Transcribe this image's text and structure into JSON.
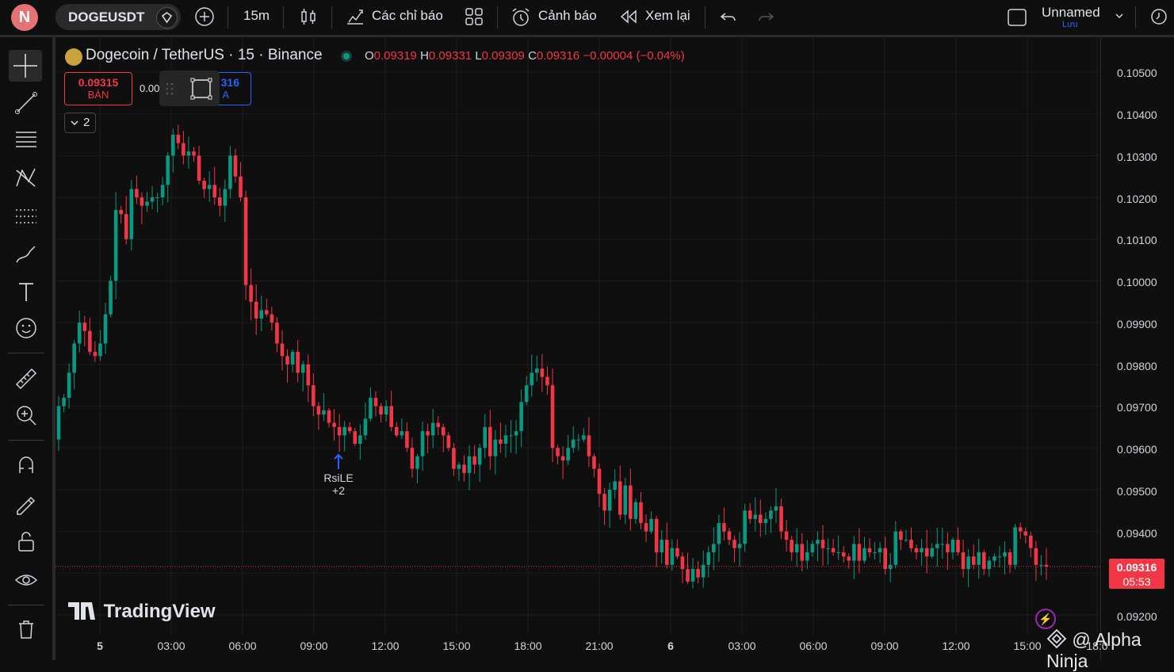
{
  "topbar": {
    "logo_letter": "N",
    "symbol": "DOGEUSDT",
    "interval": "15m",
    "indicators_label": "Các chỉ báo",
    "alerts_label": "Cảnh báo",
    "replay_label": "Xem lại",
    "layout_name": "Unnamed",
    "save_label": "Lưu"
  },
  "legend": {
    "title": "Dogecoin / TetherUS · 15 · Binance",
    "o_label": "O",
    "o_value": "0.09319",
    "h_label": "H",
    "h_value": "0.09331",
    "l_label": "L",
    "l_value": "0.09309",
    "c_label": "C",
    "c_value": "0.09316",
    "change": "−0.00004 (−0.04%)"
  },
  "trade": {
    "sell_price": "0.09315",
    "sell_label": "BÁN",
    "spread": "0.00",
    "buy_price": "316",
    "buy_label": "A",
    "collapse_count": "2"
  },
  "price_axis": [
    "0.10500",
    "0.10400",
    "0.10300",
    "0.10200",
    "0.10100",
    "0.10000",
    "0.09900",
    "0.09800",
    "0.09700",
    "0.09600",
    "0.09500",
    "0.09400",
    "0.09200"
  ],
  "time_axis": [
    "5",
    "03:00",
    "06:00",
    "09:00",
    "12:00",
    "15:00",
    "18:00",
    "21:00",
    "6",
    "03:00",
    "06:00",
    "09:00",
    "12:00",
    "15:00",
    "18:0"
  ],
  "last_price": {
    "price": "0.09316",
    "countdown": "05:53"
  },
  "signal": {
    "label": "RsiLE",
    "extra": "+2"
  },
  "branding": {
    "tradingview": "TradingView",
    "watermark": "@ Alpha Ninja"
  },
  "colors": {
    "up": "#089981",
    "down": "#f23645",
    "background": "#0f0f0f",
    "accent": "#2962ff"
  },
  "chart_data": {
    "type": "candlestick",
    "ylim": [
      0.0915,
      0.1055
    ],
    "closes": [
      0.097,
      0.0972,
      0.0978,
      0.0985,
      0.099,
      0.0988,
      0.0983,
      0.0982,
      0.0985,
      0.0992,
      0.1,
      0.1017,
      0.1016,
      0.101,
      0.1022,
      0.102,
      0.1018,
      0.1019,
      0.102,
      0.102,
      0.1023,
      0.103,
      0.1035,
      0.1033,
      0.103,
      0.1031,
      0.103,
      0.1024,
      0.1022,
      0.1023,
      0.102,
      0.1018,
      0.1022,
      0.103,
      0.1025,
      0.102,
      0.0999,
      0.0995,
      0.0991,
      0.0993,
      0.0992,
      0.099,
      0.0985,
      0.0982,
      0.098,
      0.0983,
      0.0978,
      0.098,
      0.0975,
      0.097,
      0.0968,
      0.0969,
      0.0966,
      0.0965,
      0.0963,
      0.0965,
      0.0964,
      0.0961,
      0.0963,
      0.0967,
      0.0972,
      0.097,
      0.0968,
      0.097,
      0.0965,
      0.0963,
      0.0964,
      0.096,
      0.0955,
      0.0958,
      0.0964,
      0.0963,
      0.0966,
      0.0965,
      0.0963,
      0.096,
      0.0955,
      0.0956,
      0.0954,
      0.0958,
      0.0956,
      0.096,
      0.0965,
      0.0958,
      0.0962,
      0.0961,
      0.0963,
      0.0963,
      0.0964,
      0.0971,
      0.0975,
      0.0978,
      0.0979,
      0.0977,
      0.0975,
      0.096,
      0.0958,
      0.0957,
      0.096,
      0.0962,
      0.0962,
      0.0963,
      0.0958,
      0.0955,
      0.0949,
      0.0945,
      0.095,
      0.0952,
      0.0944,
      0.0951,
      0.0943,
      0.0947,
      0.0942,
      0.094,
      0.0943,
      0.0935,
      0.0938,
      0.0932,
      0.0936,
      0.0934,
      0.0931,
      0.0928,
      0.0931,
      0.0929,
      0.0932,
      0.0935,
      0.0937,
      0.0942,
      0.094,
      0.0938,
      0.0936,
      0.0937,
      0.0945,
      0.0943,
      0.0944,
      0.0942,
      0.0943,
      0.0945,
      0.0946,
      0.094,
      0.0938,
      0.0935,
      0.0937,
      0.0933,
      0.0935,
      0.0937,
      0.0938,
      0.0936,
      0.0936,
      0.0935,
      0.0935,
      0.0934,
      0.0933,
      0.0937,
      0.0933,
      0.0936,
      0.0935,
      0.0935,
      0.0936,
      0.0931,
      0.0932,
      0.094,
      0.0938,
      0.0938,
      0.0936,
      0.0935,
      0.0936,
      0.0934,
      0.0936,
      0.0937,
      0.0937,
      0.0935,
      0.0938,
      0.0935,
      0.0931,
      0.0934,
      0.0932,
      0.0935,
      0.0931,
      0.0933,
      0.0934,
      0.0934,
      0.0935,
      0.0932,
      0.0941,
      0.094,
      0.0939,
      0.0936,
      0.0932,
      0.0932,
      0.09316
    ]
  }
}
